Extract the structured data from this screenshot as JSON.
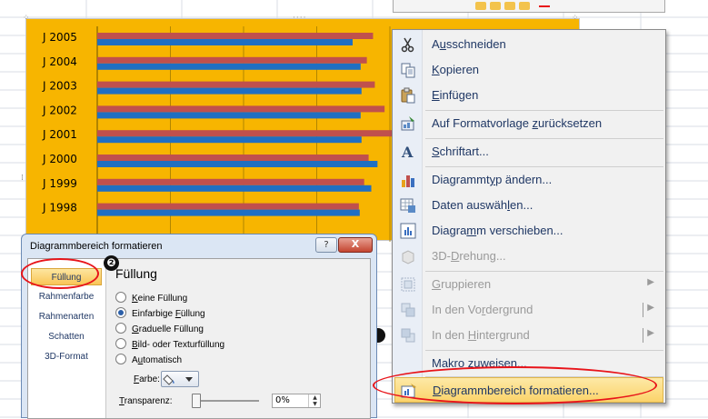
{
  "chart_data": {
    "type": "bar",
    "orientation": "horizontal",
    "categories": [
      "J 2005",
      "J 2004",
      "J 2003",
      "J 2002",
      "J 2001",
      "J 2000",
      "J 1999",
      "J 1998"
    ],
    "series": [
      {
        "color": "#c0504d",
        "values": [
          311,
          304,
          313,
          324,
          346,
          306,
          301,
          295
        ]
      },
      {
        "color": "#1f6fc3",
        "values": [
          288,
          297,
          298,
          297,
          298,
          316,
          309,
          296
        ]
      }
    ],
    "xlim": [
      0,
      330
    ],
    "grid": true,
    "title": "",
    "xlabel": "",
    "ylabel": "",
    "colors": {
      "background": "#f7b500"
    }
  },
  "context_menu": {
    "items": [
      {
        "label": "Ausschneiden",
        "icon": "scissors-icon",
        "enabled": true
      },
      {
        "label": "Kopieren",
        "icon": "copy-icon",
        "enabled": true
      },
      {
        "label": "Einfügen",
        "icon": "paste-icon",
        "enabled": true
      },
      {
        "label": "Auf Formatvorlage zurücksetzen",
        "icon": "reset-style-icon",
        "enabled": true
      },
      {
        "label": "Schriftart...",
        "icon": "font-icon",
        "enabled": true
      },
      {
        "label": "Diagrammtyp ändern...",
        "icon": "chart-type-icon",
        "enabled": true
      },
      {
        "label": "Daten auswählen...",
        "icon": "select-data-icon",
        "enabled": true
      },
      {
        "label": "Diagramm verschieben...",
        "icon": "move-chart-icon",
        "enabled": true
      },
      {
        "label": "3D-Drehung...",
        "icon": "3d-rotation-icon",
        "enabled": false
      },
      {
        "label": "Gruppieren",
        "icon": "group-icon",
        "enabled": false
      },
      {
        "label": "In den Vordergrund",
        "icon": "bring-front-icon",
        "enabled": false
      },
      {
        "label": "In den Hintergrund",
        "icon": "send-back-icon",
        "enabled": false
      },
      {
        "label": "Makro zuweisen...",
        "icon": "",
        "enabled": true
      },
      {
        "label": "Diagrammbereich formatieren...",
        "icon": "format-chart-area-icon",
        "enabled": true,
        "highlighted": true
      }
    ]
  },
  "dialog": {
    "title": "Diagrammbereich formatieren",
    "help_label": "?",
    "close_label": "X",
    "nav": [
      "Füllung",
      "Rahmenfarbe",
      "Rahmenarten",
      "Schatten",
      "3D-Format"
    ],
    "nav_selected": "Füllung",
    "content_title": "Füllung",
    "options": [
      "Keine Füllung",
      "Einfarbige Füllung",
      "Graduelle Füllung",
      "Bild- oder Texturfüllung",
      "Automatisch"
    ],
    "selected_option": "Einfarbige Füllung",
    "color_label": "Farbe:",
    "transparency_label": "Transparenz:",
    "transparency_value": "0%",
    "transparency_level": 0
  },
  "callout_badge": "❷"
}
